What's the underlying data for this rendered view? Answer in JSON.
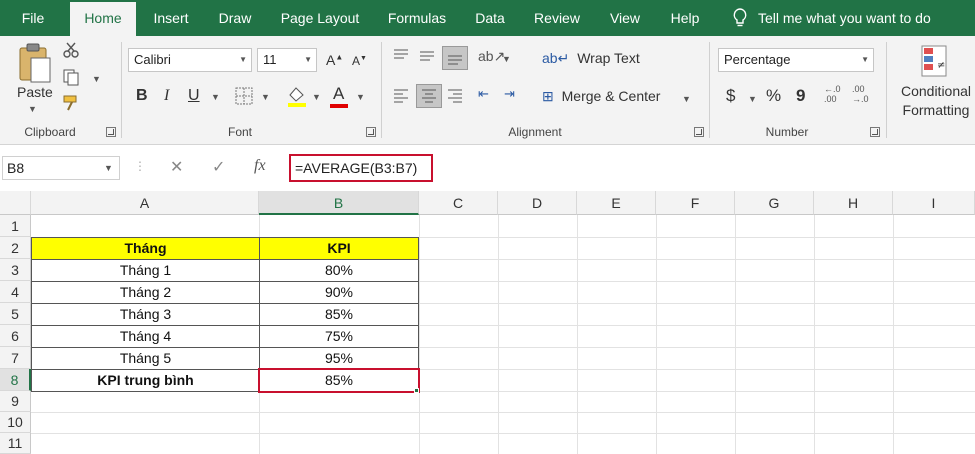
{
  "ribbon_tabs": [
    {
      "label": "File"
    },
    {
      "label": "Home"
    },
    {
      "label": "Insert"
    },
    {
      "label": "Draw"
    },
    {
      "label": "Page Layout"
    },
    {
      "label": "Formulas"
    },
    {
      "label": "Data"
    },
    {
      "label": "Review"
    },
    {
      "label": "View"
    },
    {
      "label": "Help"
    }
  ],
  "tell_me": "Tell me what you want to do",
  "clipboard": {
    "paste": "Paste",
    "label": "Clipboard"
  },
  "font": {
    "name": "Calibri",
    "size": "11",
    "label": "Font",
    "bold": "B",
    "italic": "I",
    "underline": "U"
  },
  "alignment": {
    "wrap_text": "Wrap Text",
    "merge_center": "Merge & Center",
    "label": "Alignment"
  },
  "number": {
    "format": "Percentage",
    "currency": "$",
    "percent": "%",
    "comma": "9",
    "label": "Number"
  },
  "styles": {
    "conditional_1": "Conditional",
    "conditional_2": "Formatting"
  },
  "formula_bar": {
    "name_box": "B8",
    "formula": "=AVERAGE(B3:B7)",
    "fx": "fx"
  },
  "columns": [
    "A",
    "B",
    "C",
    "D",
    "E",
    "F",
    "G",
    "H",
    "I"
  ],
  "rows": [
    "1",
    "2",
    "3",
    "4",
    "5",
    "6",
    "7",
    "8",
    "9",
    "10",
    "11"
  ],
  "table": {
    "header": {
      "month": "Tháng",
      "kpi": "KPI"
    },
    "data": [
      {
        "month": "Tháng 1",
        "kpi": "80%"
      },
      {
        "month": "Tháng 2",
        "kpi": "90%"
      },
      {
        "month": "Tháng 3",
        "kpi": "85%"
      },
      {
        "month": "Tháng 4",
        "kpi": "75%"
      },
      {
        "month": "Tháng 5",
        "kpi": "95%"
      }
    ],
    "average": {
      "label": "KPI trung bình",
      "value": "85%"
    }
  },
  "colors": {
    "accent": "#217346",
    "highlight": "#ffff00",
    "selection_border": "#c8102e"
  }
}
